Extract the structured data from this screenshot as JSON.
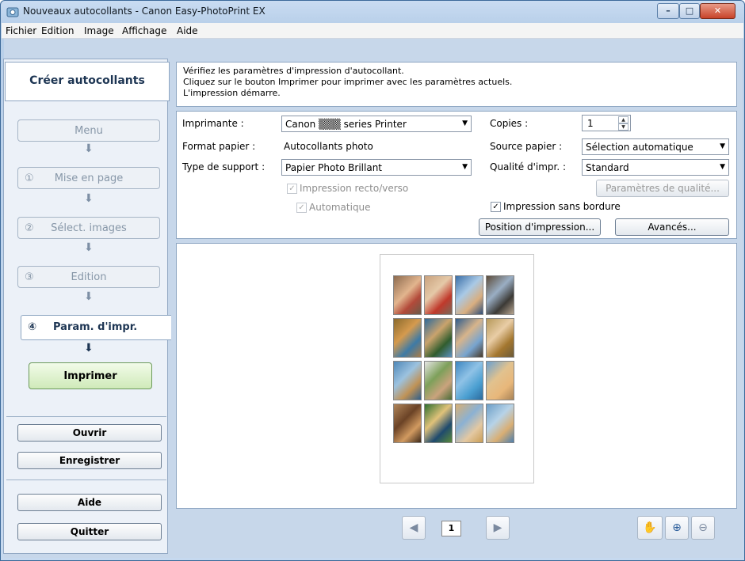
{
  "window": {
    "title": "Nouveaux autocollants - Canon Easy-PhotoPrint EX"
  },
  "menu": [
    "Fichier",
    "Edition",
    "Image",
    "Affichage",
    "Aide"
  ],
  "sidebar": {
    "title": "Créer autocollants",
    "steps": [
      {
        "num": "",
        "label": "Menu"
      },
      {
        "num": "①",
        "label": "Mise en page"
      },
      {
        "num": "②",
        "label": "Sélect. images"
      },
      {
        "num": "③",
        "label": "Edition"
      }
    ],
    "active_step": {
      "num": "④",
      "label": "Param. d'impr."
    },
    "print_label": "Imprimer",
    "buttons": {
      "open": "Ouvrir",
      "save": "Enregistrer",
      "help": "Aide",
      "quit": "Quitter"
    }
  },
  "info": {
    "lines": [
      "Vérifiez les paramètres d'impression d'autocollant.",
      "Cliquez sur le bouton Imprimer pour imprimer avec les paramètres actuels.",
      "L'impression démarre."
    ]
  },
  "settings": {
    "printer_label": "Imprimante :",
    "printer_value": "Canon ▒▒▒ series Printer",
    "paper_size_label": "Format papier :",
    "paper_size_value": "Autocollants photo",
    "media_type_label": "Type de support :",
    "media_type_value": "Papier Photo Brillant",
    "duplex_label": "Impression recto/verso",
    "automatic_label": "Automatique",
    "copies_label": "Copies :",
    "copies_value": "1",
    "paper_source_label": "Source papier :",
    "paper_source_value": "Sélection automatique",
    "quality_label": "Qualité d'impr. :",
    "quality_value": "Standard",
    "quality_settings_label": "Paramètres de qualité...",
    "borderless_label": "Impression sans bordure",
    "borderless_checked": true,
    "print_position_label": "Position d'impression...",
    "advanced_label": "Avancés..."
  },
  "preview": {
    "page": "1",
    "photo_count": 16
  },
  "colors": {
    "accent": "#1d3553",
    "print_button": "#cfeab9",
    "window_frame": "#c6d9ef"
  }
}
